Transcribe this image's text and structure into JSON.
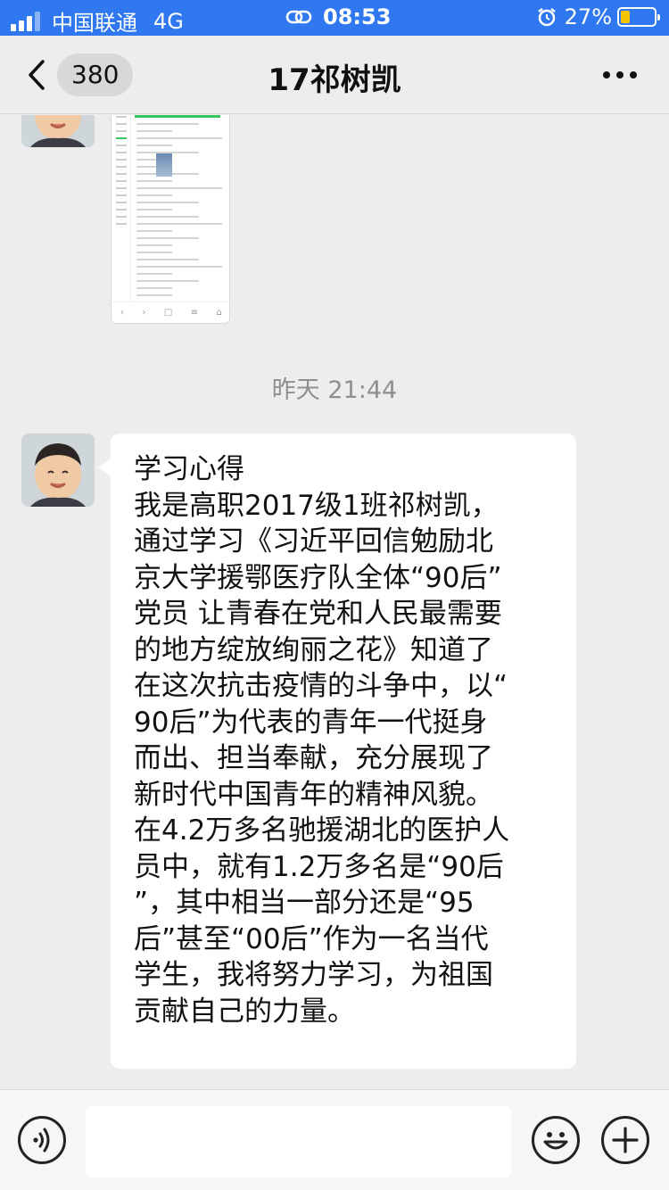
{
  "status_bar": {
    "carrier": "中国联通",
    "network": "4G",
    "time": "08:53",
    "battery_percent": "27%",
    "battery_level": 0.27
  },
  "nav": {
    "unread_count": "380",
    "title": "17祁树凯"
  },
  "chat": {
    "timestamp": "昨天 21:44",
    "message_lines": [
      "学习心得",
      "我是高职2017级1班祁树凯，",
      "通过学习《习近平回信勉励北",
      "京大学援鄂医疗队全体“90后”",
      "党员 让青春在党和人民最需要",
      "的地方绽放绚丽之花》知道了",
      "在这次抗击疫情的斗争中，以“",
      "90后”为代表的青年一代挺身",
      "而出、担当奉献，充分展现了",
      "新时代中国青年的精神风貌。",
      "在4.2万多名驰援湖北的医护人",
      "员中，就有1.2万多名是“90后",
      "”，其中相当一部分还是“95",
      "后”甚至“00后”作为一名当代",
      "学生，我将努力学习，为祖国",
      "贡献自己的力量。"
    ]
  },
  "input": {
    "value": "",
    "placeholder": ""
  },
  "colors": {
    "status_bar_bg": "#2f78f0",
    "chat_bg": "#ededed",
    "bubble_bg": "#ffffff",
    "battery_fill": "#f5c400"
  }
}
